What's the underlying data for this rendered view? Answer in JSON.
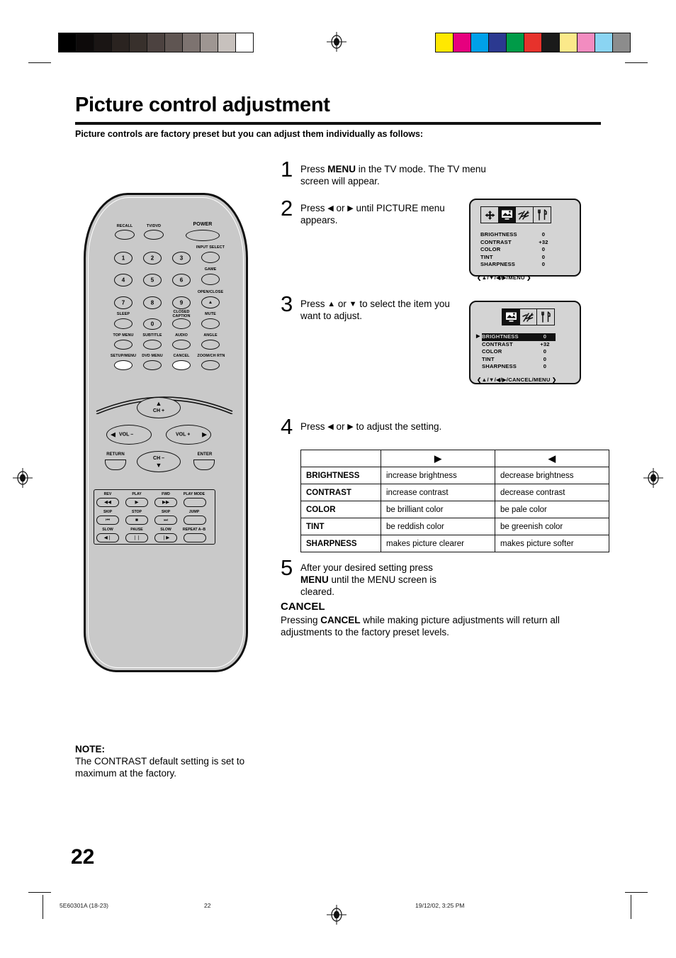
{
  "page": {
    "title": "Picture control adjustment",
    "subtitle": "Picture controls are factory preset but you can adjust them individually as follows:",
    "number": "22"
  },
  "steps": [
    {
      "num": "1",
      "html_parts": [
        "Press ",
        "MENU",
        " in the TV mode. The TV menu screen will appear."
      ]
    },
    {
      "num": "2",
      "html_parts": [
        "Press ",
        "◀",
        " or ",
        "▶",
        " until PICTURE menu appears."
      ]
    },
    {
      "num": "3",
      "html_parts": [
        "Press ",
        "▲",
        " or ",
        "▼",
        " to select the item you want to adjust."
      ]
    },
    {
      "num": "4",
      "html_parts": [
        "Press ",
        "◀",
        " or ",
        "▶",
        " to adjust the setting."
      ]
    },
    {
      "num": "5",
      "html_parts": [
        "After your desired setting press ",
        "MENU",
        " until the MENU screen is cleared."
      ]
    }
  ],
  "step1": {
    "num": "1",
    "t1": "Press ",
    "b1": "MENU",
    "t2": " in the TV mode. The TV menu screen will appear."
  },
  "step2": {
    "num": "2",
    "t1": "Press ",
    "a1": "◀",
    "t2": " or ",
    "a2": "▶",
    "t3": " until PICTURE menu appears."
  },
  "step3": {
    "num": "3",
    "t1": "Press ",
    "a1": "▲",
    "t2": " or ",
    "a2": "▼",
    "t3": " to select the item you want to adjust."
  },
  "step4": {
    "num": "4",
    "t1": "Press ",
    "a1": "◀",
    "t2": " or ",
    "a2": "▶",
    "t3": " to adjust the setting."
  },
  "step5": {
    "num": "5",
    "t1": "After your desired setting press ",
    "b1": "MENU",
    "t2": " until the MENU screen is cleared."
  },
  "menu_screen_1": {
    "icons": [
      "position-icon",
      "picture-icon",
      "signal-icon",
      "setup-icon"
    ],
    "selected_icon": "picture-icon",
    "rows": [
      {
        "label": "BRIGHTNESS",
        "value": "0"
      },
      {
        "label": "CONTRAST",
        "value": "+32"
      },
      {
        "label": "COLOR",
        "value": "0"
      },
      {
        "label": "TINT",
        "value": "0"
      },
      {
        "label": "SHARPNESS",
        "value": "0"
      }
    ],
    "footer": "❮▲/▼/◀/▶/MENU ❯"
  },
  "menu_screen_2": {
    "icons": [
      "picture-icon",
      "signal-icon",
      "setup-icon"
    ],
    "selected_icon": "picture-icon",
    "pointer": "▶",
    "highlighted_row": "BRIGHTNESS",
    "rows": [
      {
        "label": "BRIGHTNESS",
        "value": "0"
      },
      {
        "label": "CONTRAST",
        "value": "+32"
      },
      {
        "label": "COLOR",
        "value": "0"
      },
      {
        "label": "TINT",
        "value": "0"
      },
      {
        "label": "SHARPNESS",
        "value": "0"
      }
    ],
    "footer": "❮▲/▼/◀/▶/CANCEL/MENU ❯"
  },
  "adjust_table": {
    "headers": [
      "",
      "▶",
      "◀"
    ],
    "rows": [
      {
        "item": "BRIGHTNESS",
        "right": "increase brightness",
        "left": "decrease brightness"
      },
      {
        "item": "CONTRAST",
        "right": "increase contrast",
        "left": "decrease contrast"
      },
      {
        "item": "COLOR",
        "right": "be brilliant color",
        "left": "be pale color"
      },
      {
        "item": "TINT",
        "right": "be reddish color",
        "left": "be greenish color"
      },
      {
        "item": "SHARPNESS",
        "right": "makes picture clearer",
        "left": "makes picture softer"
      }
    ]
  },
  "cancel": {
    "heading": "CANCEL",
    "t1": "Pressing ",
    "b1": "CANCEL",
    "t2": " while making picture adjustments will return all adjustments to the factory preset levels."
  },
  "note": {
    "heading": "NOTE:",
    "text": "The CONTRAST default setting is set to maximum at the factory."
  },
  "footer": {
    "doc_id": "5E60301A (18-23)",
    "page": "22",
    "timestamp": "19/12/02, 3:25 PM"
  },
  "reg_marks": {
    "gray_ramp": [
      "#000000",
      "#0d0a0a",
      "#1a1514",
      "#2a2320",
      "#38302c",
      "#4c4240",
      "#5f5552",
      "#7d7370",
      "#9e9692",
      "#c7c1bd",
      "#ffffff"
    ],
    "color_patches": [
      "#ffe800",
      "#e6007e",
      "#00a0e9",
      "#2b3990",
      "#009b48",
      "#e7322c",
      "#1a1a1a",
      "#fbe98a",
      "#f28cc0",
      "#8ad4f2",
      "#8c8c8c"
    ]
  },
  "remote": {
    "top_row": [
      {
        "label": "RECALL",
        "name": "recall"
      },
      {
        "label": "TV/DVD",
        "name": "tv-dvd"
      },
      {
        "label": "POWER",
        "name": "power"
      }
    ],
    "right_column": [
      {
        "label": "INPUT SELECT",
        "name": "input-select"
      },
      {
        "label": "GAME",
        "name": "game"
      },
      {
        "label": "OPEN/CLOSE",
        "name": "open-close"
      },
      {
        "label": "MUTE",
        "name": "mute"
      }
    ],
    "numbers": [
      "1",
      "2",
      "3",
      "4",
      "5",
      "6",
      "7",
      "8",
      "9",
      "0"
    ],
    "function_labels": [
      {
        "label": "SLEEP",
        "name": "sleep"
      },
      {
        "label": "CLOSED CAPTION",
        "name": "closed-caption"
      },
      {
        "label": "TOP MENU",
        "name": "top-menu"
      },
      {
        "label": "SUBTITLE",
        "name": "subtitle"
      },
      {
        "label": "AUDIO",
        "name": "audio"
      },
      {
        "label": "ANGLE",
        "name": "angle"
      },
      {
        "label": "SETUP/MENU",
        "name": "setup-menu"
      },
      {
        "label": "DVD MENU",
        "name": "dvd-menu"
      },
      {
        "label": "CANCEL",
        "name": "cancel"
      },
      {
        "label": "ZOOM/CH RTN",
        "name": "zoom-ch-rtn"
      }
    ],
    "highlighted_buttons": [
      "SETUP/MENU",
      "CANCEL"
    ],
    "dpad": {
      "up": "CH +",
      "down": "CH –",
      "left": "VOL –",
      "right": "VOL +",
      "return": "RETURN",
      "enter": "ENTER"
    },
    "transport": [
      {
        "label": "REV",
        "glyph": "◀◀"
      },
      {
        "label": "PLAY",
        "glyph": "▶"
      },
      {
        "label": "FWD",
        "glyph": "▶▶"
      },
      {
        "label": "PLAY MODE",
        "glyph": ""
      },
      {
        "label": "SKIP",
        "glyph": "⏮"
      },
      {
        "label": "STOP",
        "glyph": "■"
      },
      {
        "label": "SKIP",
        "glyph": "⏭"
      },
      {
        "label": "JUMP",
        "glyph": ""
      },
      {
        "label": "SLOW",
        "glyph": "◀❘"
      },
      {
        "label": "PAUSE",
        "glyph": "❘❘"
      },
      {
        "label": "SLOW",
        "glyph": "❘▶"
      },
      {
        "label": "REPEAT A–B",
        "glyph": ""
      }
    ]
  }
}
